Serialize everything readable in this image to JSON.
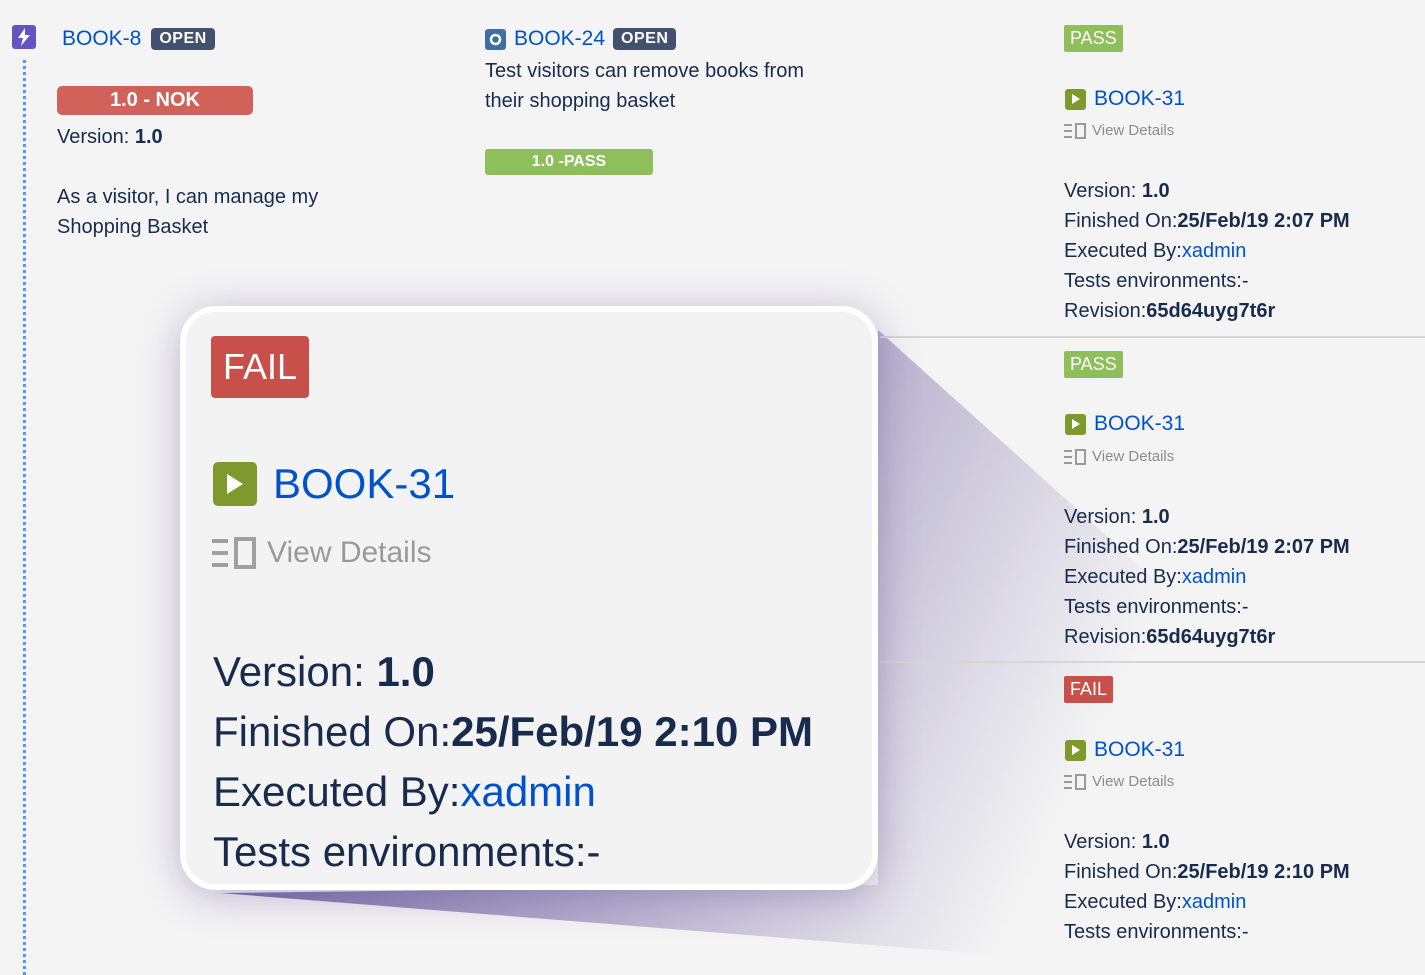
{
  "requirement": {
    "key": "BOOK-8",
    "status": "OPEN",
    "version_status": "1.0 - NOK",
    "version_label": "Version: ",
    "version_value": "1.0",
    "summary_line1": "As a visitor, I can manage my",
    "summary_line2": "Shopping Basket"
  },
  "test": {
    "key": "BOOK-24",
    "status": "OPEN",
    "summary_line1": "Test visitors can remove books from",
    "summary_line2": "their shopping basket",
    "version_status": "1.0 -PASS"
  },
  "runs": [
    {
      "status": "PASS",
      "exec_key": "BOOK-31",
      "view_details": "View Details",
      "version_label": "Version: ",
      "version_value": "1.0",
      "finished_label": "Finished On:",
      "finished_value": "25/Feb/19 2:07 PM",
      "executed_label": "Executed By:",
      "executed_value": "xadmin",
      "env_label": "Tests environments:-",
      "revision_label": "Revision:",
      "revision_value": "65d64uyg7t6r"
    },
    {
      "status": "PASS",
      "exec_key": "BOOK-31",
      "view_details": "View Details",
      "version_label": "Version: ",
      "version_value": "1.0",
      "finished_label": "Finished On:",
      "finished_value": "25/Feb/19 2:07 PM",
      "executed_label": "Executed By:",
      "executed_value": "xadmin",
      "env_label": "Tests environments:-",
      "revision_label": "Revision:",
      "revision_value": "65d64uyg7t6r"
    },
    {
      "status": "FAIL",
      "exec_key": "BOOK-31",
      "view_details": "View Details",
      "version_label": "Version: ",
      "version_value": "1.0",
      "finished_label": "Finished On:",
      "finished_value": "25/Feb/19 2:10 PM",
      "executed_label": "Executed By:",
      "executed_value": "xadmin",
      "env_label": "Tests environments:-"
    }
  ],
  "zoom": {
    "status": "FAIL",
    "exec_key": "BOOK-31",
    "view_details": "View Details",
    "version_label": "Version: ",
    "version_value": "1.0",
    "finished_label": "Finished On:",
    "finished_value": "25/Feb/19 2:10 PM",
    "executed_label": "Executed By:",
    "executed_value": "xadmin",
    "env_label": "Tests environments:-"
  },
  "colors": {
    "link": "#0052cc",
    "pass": "#8fbf5a",
    "fail": "#c9504a",
    "nok": "#d0625a",
    "lozenge": "#42526e",
    "epic": "#6554c0"
  }
}
